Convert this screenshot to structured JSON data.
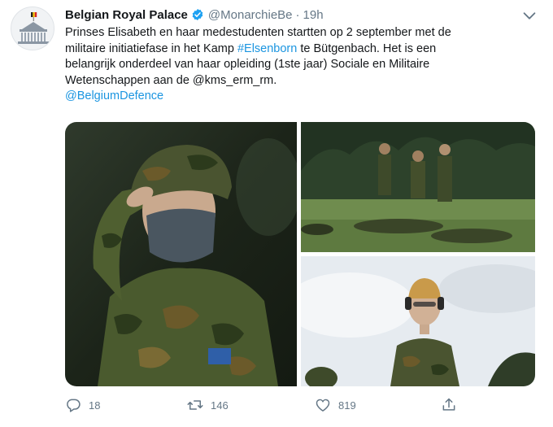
{
  "tweet": {
    "author": {
      "name": "Belgian Royal Palace",
      "handle": "@MonarchieBe",
      "separator": "·",
      "time": "19h"
    },
    "text": {
      "line1": "Prinses Elisabeth en haar medestudenten startten op 2 september met de",
      "line2_pre": "militaire initiatiefase in het Kamp ",
      "hashtag": "#Elsenborn",
      "line2_post": " te Bütgenbach. Het is een",
      "line3": "belangrijk onderdeel van haar opleiding (1ste jaar) Sociale en Militaire",
      "line4": "Wetenschappen aan de @kms_erm_rm.",
      "mention": "@BelgiumDefence"
    },
    "metrics": {
      "replies": "18",
      "retweets": "146",
      "likes": "819"
    },
    "icons": [
      "verified-badge-icon",
      "chevron-down-icon",
      "reply-icon",
      "retweet-icon",
      "like-icon",
      "share-icon"
    ],
    "colors": {
      "accent": "#1b95e0",
      "text": "#14171a",
      "muted": "#657786"
    }
  }
}
